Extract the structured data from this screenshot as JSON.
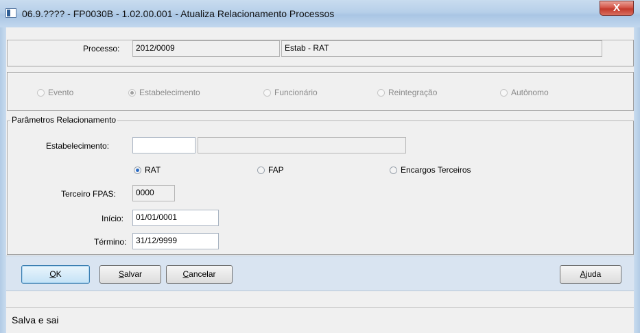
{
  "window": {
    "title": "06.9.???? - FP0030B - 1.02.00.001 - Atualiza Relacionamento Processos",
    "close_glyph": "X"
  },
  "processo": {
    "label": "Processo:",
    "value": "2012/0009",
    "description": "Estab - RAT"
  },
  "tipo": {
    "options": [
      {
        "label": "Evento",
        "checked": false
      },
      {
        "label": "Estabelecimento",
        "checked": true
      },
      {
        "label": "Funcionário",
        "checked": false
      },
      {
        "label": "Reintegração",
        "checked": false
      },
      {
        "label": "Autônomo",
        "checked": false
      }
    ]
  },
  "parametros": {
    "legend": "Parâmetros Relacionamento",
    "estabelecimento_label": "Estabelecimento:",
    "estabelecimento_value": "",
    "estabelecimento_desc": "",
    "encargo_options": [
      {
        "label": "RAT",
        "checked": true
      },
      {
        "label": "FAP",
        "checked": false
      },
      {
        "label": "Encargos Terceiros",
        "checked": false
      }
    ],
    "terceiro_label": "Terceiro FPAS:",
    "terceiro_value": "0000",
    "inicio_label": "Início:",
    "inicio_value": "01/01/0001",
    "termino_label": "Término:",
    "termino_value": "31/12/9999"
  },
  "buttons": {
    "ok": {
      "label": "OK",
      "mnemonic_index": 0
    },
    "salvar": {
      "label": "Salvar",
      "mnemonic_index": 0
    },
    "cancelar": {
      "label": "Cancelar",
      "mnemonic_index": 0
    },
    "ajuda": {
      "label": "Ajuda",
      "mnemonic_index": 0
    }
  },
  "status": {
    "text": "Salva e sai"
  }
}
